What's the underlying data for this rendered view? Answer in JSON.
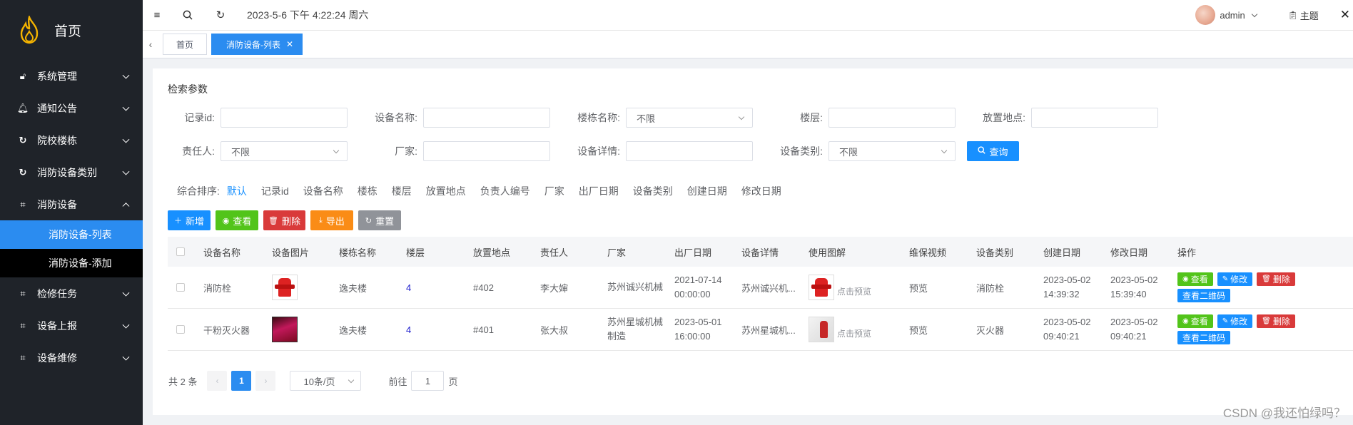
{
  "app": {
    "title": "首页"
  },
  "sidebar": {
    "items": [
      {
        "label": "系统管理",
        "icon": "lock-icon",
        "glyph": "🔓"
      },
      {
        "label": "通知公告",
        "icon": "bell-icon",
        "glyph": "🔔"
      },
      {
        "label": "院校楼栋",
        "icon": "refresh-icon",
        "glyph": "↻"
      },
      {
        "label": "消防设备类别",
        "icon": "refresh-icon",
        "glyph": "↻"
      },
      {
        "label": "消防设备",
        "icon": "crop-icon",
        "glyph": "⌗"
      },
      {
        "label": "检修任务",
        "icon": "crop-icon",
        "glyph": "⌗"
      },
      {
        "label": "设备上报",
        "icon": "crop-icon",
        "glyph": "⌗"
      },
      {
        "label": "设备维修",
        "icon": "crop-icon",
        "glyph": "⌗"
      }
    ],
    "submenu": [
      {
        "label": "消防设备-列表"
      },
      {
        "label": "消防设备-添加"
      }
    ]
  },
  "topbar": {
    "datetime": "2023-5-6 下午 4:22:24 周六",
    "username": "admin",
    "theme": "主题"
  },
  "tabs": [
    {
      "label": "首页"
    },
    {
      "label": "消防设备-列表"
    }
  ],
  "search": {
    "title": "检索参数",
    "fields": {
      "record_id": {
        "label": "记录id:",
        "value": ""
      },
      "device_name": {
        "label": "设备名称:",
        "value": ""
      },
      "building": {
        "label": "楼栋名称:",
        "value": "不限"
      },
      "floor": {
        "label": "楼层:",
        "value": ""
      },
      "location": {
        "label": "放置地点:",
        "value": ""
      },
      "owner": {
        "label": "责任人:",
        "value": "不限"
      },
      "manufacturer": {
        "label": "厂家:",
        "value": ""
      },
      "details": {
        "label": "设备详情:",
        "value": ""
      },
      "category": {
        "label": "设备类别:",
        "value": "不限"
      }
    },
    "query_label": "查询"
  },
  "sort": {
    "label": "综合排序:",
    "options": [
      "默认",
      "记录id",
      "设备名称",
      "楼栋",
      "楼层",
      "放置地点",
      "负责人编号",
      "厂家",
      "出厂日期",
      "设备类别",
      "创建日期",
      "修改日期"
    ]
  },
  "actions": {
    "add": "新增",
    "view": "查看",
    "delete": "删除",
    "export": "导出",
    "reset": "重置"
  },
  "table": {
    "headers": [
      "设备名称",
      "设备图片",
      "楼栋名称",
      "楼层",
      "放置地点",
      "责任人",
      "厂家",
      "出厂日期",
      "设备详情",
      "使用图解",
      "维保视频",
      "设备类别",
      "创建日期",
      "修改日期",
      "操作"
    ],
    "rows": [
      {
        "name": "消防栓",
        "building": "逸夫楼",
        "floor": "4",
        "location": "#402",
        "owner": "李大婶",
        "manufacturer": "苏州诚兴机械",
        "manufacturer2": "",
        "factory_date": "2021-07-14",
        "factory_time": "00:00:00",
        "details": "苏州诚兴机...",
        "preview": "点击预览",
        "video": "预览",
        "category": "消防栓",
        "created_date": "2023-05-02",
        "created_time": "14:39:32",
        "modified_date": "2023-05-02",
        "modified_time": "15:39:40"
      },
      {
        "name": "干粉灭火器",
        "building": "逸夫楼",
        "floor": "4",
        "location": "#401",
        "owner": "张大叔",
        "manufacturer": "苏州星城机械",
        "manufacturer2": "制造",
        "factory_date": "2023-05-01",
        "factory_time": "16:00:00",
        "details": "苏州星城机...",
        "preview": "点击预览",
        "video": "预览",
        "category": "灭火器",
        "created_date": "2023-05-02",
        "created_time": "09:40:21",
        "modified_date": "2023-05-02",
        "modified_time": "09:40:21"
      }
    ],
    "row_actions": {
      "view": "查看",
      "edit": "修改",
      "delete": "删除",
      "qrcode": "查看二维码"
    }
  },
  "pagination": {
    "total": "共 2 条",
    "current": "1",
    "page_size": "10条/页",
    "goto_prefix": "前往",
    "goto_value": "1",
    "goto_suffix": "页"
  },
  "watermark": "CSDN @我还怕绿吗？",
  "colors": {
    "sidebar_bg": "#1f2329",
    "active_blue": "#2b8cf0",
    "primary": "#1890ff",
    "success": "#52c41a",
    "danger": "#d93a3a",
    "warning": "#fa8c16",
    "neutral": "#909399"
  }
}
